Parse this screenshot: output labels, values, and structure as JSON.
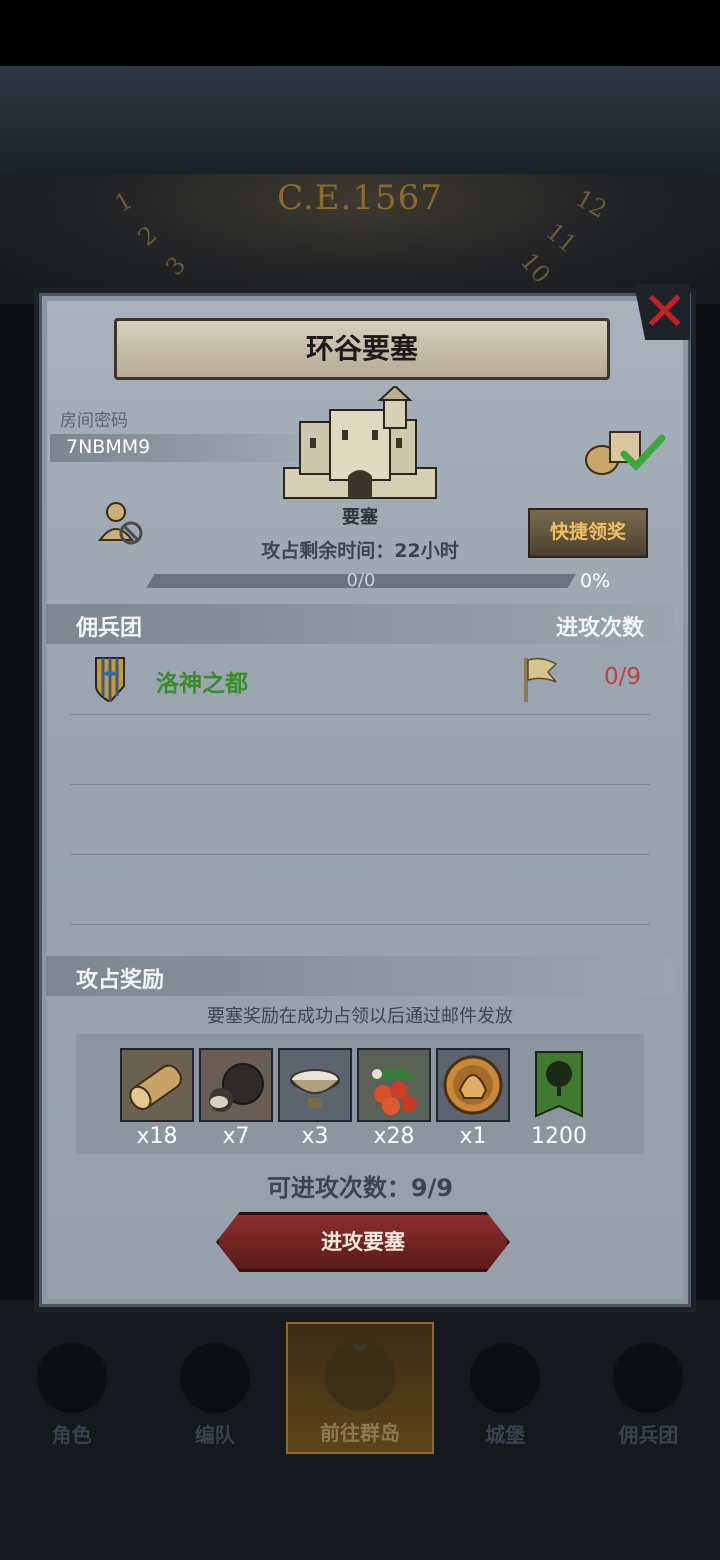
{
  "background": {
    "era_text": "C.E.1567",
    "clock_numerals": [
      "1",
      "2",
      "3",
      "11",
      "12",
      "10"
    ]
  },
  "panel": {
    "title": "环谷要塞",
    "room": {
      "label": "房间密码",
      "code": "7NBMM9"
    },
    "fortress_type": "要塞",
    "quick_claim_label": "快捷领奖",
    "remaining_time": "攻占剩余时间：22小时",
    "progress": {
      "text": "0/0",
      "percent_text": "0%",
      "value": 0
    },
    "mercenary_section": {
      "title": "佣兵团",
      "attacks_header": "进攻次数"
    },
    "mercenaries": [
      {
        "name": "洛神之都",
        "attacks": "0/9",
        "shield_icon": "bird-shield-icon",
        "flag_icon": "flag-icon"
      }
    ],
    "rewards_section": {
      "title": "攻占奖励",
      "note": "要塞奖励在成功占领以后通过邮件发放",
      "items": [
        {
          "icon": "wood-log-icon",
          "count": "x18"
        },
        {
          "icon": "ore-icon",
          "count": "x7"
        },
        {
          "icon": "bowl-icon",
          "count": "x3"
        },
        {
          "icon": "berries-icon",
          "count": "x28"
        },
        {
          "icon": "helmet-medal-icon",
          "count": "x1"
        },
        {
          "icon": "tree-banner-icon",
          "count": "1200"
        }
      ]
    },
    "attacks_remaining": "可进攻次数：9/9",
    "attack_button_label": "进攻要塞"
  },
  "nav": {
    "items": [
      {
        "label": "角色",
        "icon": "knight-icon",
        "active": false
      },
      {
        "label": "编队",
        "icon": "helmet-icon",
        "active": false
      },
      {
        "label": "前往群岛",
        "icon": "islands-icon",
        "active": true
      },
      {
        "label": "城堡",
        "icon": "castle-icon",
        "active": false
      },
      {
        "label": "佣兵团",
        "icon": "mercenary-ship-icon",
        "active": false
      }
    ]
  }
}
